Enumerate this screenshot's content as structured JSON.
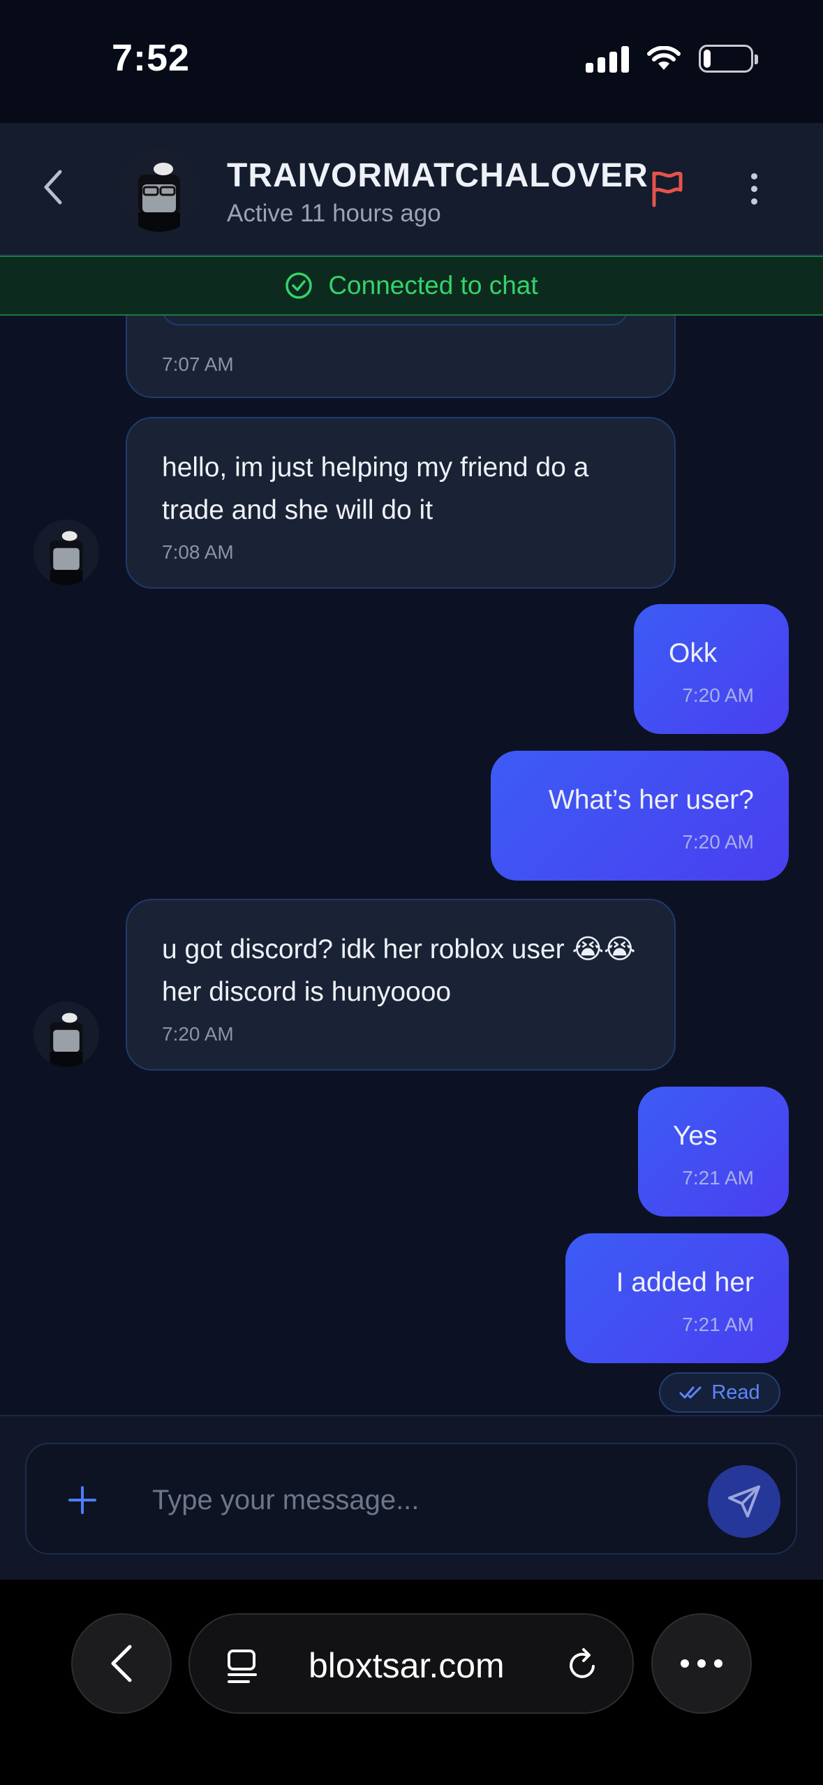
{
  "status_bar": {
    "time": "7:52"
  },
  "header": {
    "name": "TRAIVORMATCHALOVER",
    "status": "Active 11 hours ago"
  },
  "banner": {
    "text": "Connected to chat"
  },
  "messages": [
    {
      "direction": "in",
      "text": "",
      "time": "7:07 AM"
    },
    {
      "direction": "in",
      "text": "hello, im just helping my friend do a trade and she will do it",
      "time": "7:08 AM"
    },
    {
      "direction": "out",
      "text": "Okk",
      "time": "7:20 AM"
    },
    {
      "direction": "out",
      "text": "What’s her user?",
      "time": "7:20 AM"
    },
    {
      "direction": "in",
      "text": "u got discord? idk her roblox user 😭😭 her discord is hunyoooo",
      "time": "7:20 AM"
    },
    {
      "direction": "out",
      "text": "Yes",
      "time": "7:21 AM"
    },
    {
      "direction": "out",
      "text": "I added her",
      "time": "7:21 AM"
    }
  ],
  "read_receipt": "Read",
  "composer": {
    "placeholder": "Type your message..."
  },
  "browser": {
    "url": "bloxtsar.com"
  },
  "colors": {
    "outgoing_bubble": "#3c5cf5",
    "incoming_bubble": "#1a2335",
    "connected_green": "#34d36b",
    "report_flag": "#e5534b"
  }
}
